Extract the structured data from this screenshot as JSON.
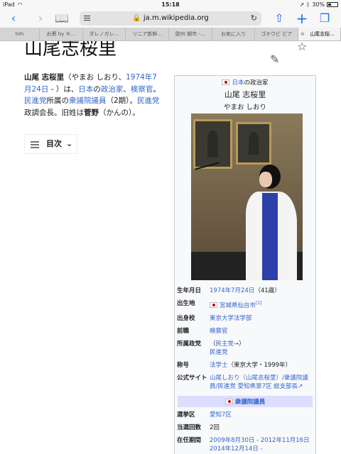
{
  "status": {
    "device": "iPad",
    "time": "15:18",
    "battery": "30%",
    "battery_level": 0.3
  },
  "toolbar": {
    "url": "ja.m.wikipedia.org"
  },
  "tabs": [
    "tim",
    "お粥 by キ...",
    "ダレノガレ...",
    "リニア新幹...",
    "欧州 朝市 -...",
    "お気に入り",
    "ゴホウビ ピア",
    "山尾志桜..."
  ],
  "article": {
    "title": "山尾志桜里",
    "intro": {
      "name": "山尾 志桜里",
      "p1": "（やまお しおり、",
      "birth_link": "1974年7月24日",
      "p2": " - ）は、",
      "link_japan": "日本",
      "p3": "の",
      "link_politician": "政治家",
      "p4": "、",
      "link_prosecutor": "検察官",
      "p5": "。",
      "link_dpj": "民進党",
      "p6": "所属の",
      "link_house": "衆議院議員",
      "p7": "（2期）。",
      "link_dpj2": "民進党",
      "p8": "政調会長。旧姓は",
      "maiden": "菅野",
      "p9": "（かんの）。"
    },
    "toc_label": "目次"
  },
  "infobox": {
    "subtitle_link": "日本",
    "subtitle_text": "の政治家",
    "name": "山尾 志桜里",
    "reading": "やまお しおり",
    "rows": [
      {
        "k": "生年月日",
        "link": "1974年7月24日",
        "text": "（41歳）"
      },
      {
        "k": "出生地",
        "link": "宮城県仙台市",
        "sup": "[1]"
      },
      {
        "k": "出身校",
        "link": "東京大学法学部"
      },
      {
        "k": "前職",
        "link": "検察官"
      },
      {
        "k": "所属政党",
        "paren_link": "民主党→",
        "link": "民進党"
      },
      {
        "k": "称号",
        "link": "法学士",
        "text": "（東京大学・1999年）"
      },
      {
        "k": "公式サイト",
        "link": "山尾しおり（山尾志桜里）/衆議院議員/民進党 愛知県第7区 総支部長"
      }
    ],
    "section_title": "衆議院議員",
    "rows2": [
      {
        "k": "選挙区",
        "link": "愛知7区"
      },
      {
        "k": "当選回数",
        "text": "2回"
      },
      {
        "k": "在任期間",
        "link": "2009年8月30日 - 2012年11月16日",
        "link2": "2014年12月14日 -"
      }
    ]
  }
}
